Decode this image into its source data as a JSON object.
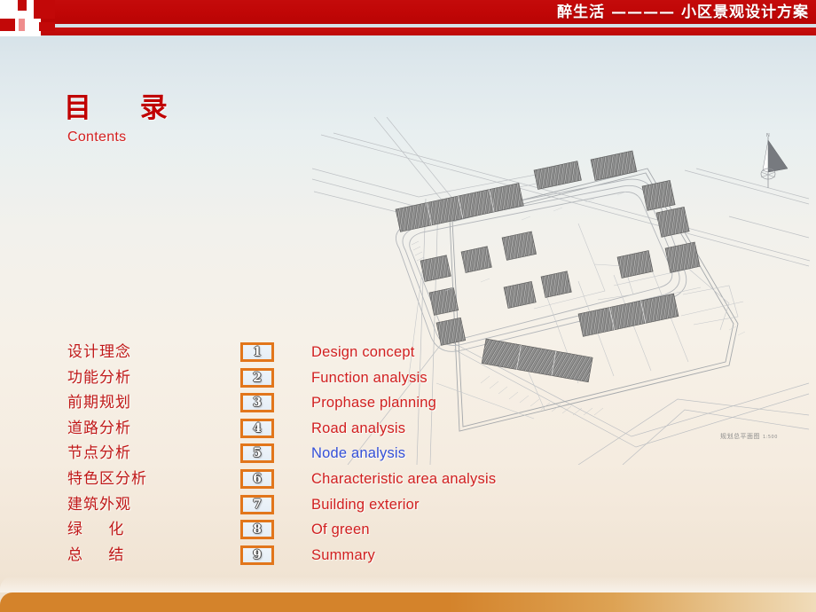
{
  "header": {
    "title": "醉生活 ———— 小区景观设计方案",
    "logo_icon": "brand-logo-icon",
    "brand_red": "#c00606"
  },
  "contents": {
    "title_cn": "目 录",
    "title_en": "Contents",
    "accent_red": "#c00000"
  },
  "siteplan": {
    "caption_cn": "规划总平面图",
    "caption_scale": "1:500",
    "north_icon": "north-arrow-icon",
    "alt": "residential site master plan line drawing"
  },
  "toc": {
    "active_index": 4,
    "active_color": "#3450d8",
    "box_border_color": "#e2761b",
    "items": [
      {
        "num": "1",
        "cn": "设计理念",
        "en": "Design concept",
        "spaced": false
      },
      {
        "num": "2",
        "cn": "功能分析",
        "en": "Function analysis",
        "spaced": false
      },
      {
        "num": "3",
        "cn": "前期规划",
        "en": "Prophase planning",
        "spaced": false
      },
      {
        "num": "4",
        "cn": "道路分析",
        "en": "Road analysis",
        "spaced": false
      },
      {
        "num": "5",
        "cn": "节点分析",
        "en": "Node analysis",
        "spaced": false
      },
      {
        "num": "6",
        "cn": "特色区分析",
        "en": "Characteristic area analysis",
        "spaced": false
      },
      {
        "num": "7",
        "cn": "建筑外观",
        "en": "Building exterior",
        "spaced": false
      },
      {
        "num": "8",
        "cn": "绿 化",
        "en": "Of green",
        "spaced": true
      },
      {
        "num": "9",
        "cn": "总 结",
        "en": "Summary",
        "spaced": true
      }
    ]
  },
  "footer": {
    "bar_color": "#d4832b"
  }
}
